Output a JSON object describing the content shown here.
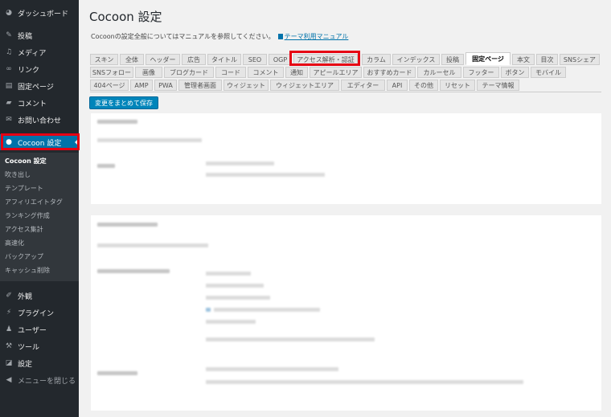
{
  "sidebar": {
    "items": [
      {
        "label": "ダッシュボード",
        "icon": "dashboard-icon"
      },
      {
        "label": "投稿",
        "icon": "pin-icon"
      },
      {
        "label": "メディア",
        "icon": "media-icon"
      },
      {
        "label": "リンク",
        "icon": "link-icon"
      },
      {
        "label": "固定ページ",
        "icon": "page-icon"
      },
      {
        "label": "コメント",
        "icon": "comment-icon"
      },
      {
        "label": "お問い合わせ",
        "icon": "mail-icon"
      },
      {
        "label": "Cocoon 設定",
        "icon": "cocoon-icon"
      },
      {
        "label": "外観",
        "icon": "brush-icon"
      },
      {
        "label": "プラグイン",
        "icon": "plugin-icon"
      },
      {
        "label": "ユーザー",
        "icon": "user-icon"
      },
      {
        "label": "ツール",
        "icon": "wrench-icon"
      },
      {
        "label": "設定",
        "icon": "settings-icon"
      },
      {
        "label": "メニューを閉じる",
        "icon": "collapse-icon"
      }
    ],
    "submenu": [
      "Cocoon 設定",
      "吹き出し",
      "テンプレート",
      "アフィリエイトタグ",
      "ランキング作成",
      "アクセス集計",
      "高速化",
      "バックアップ",
      "キャッシュ削除"
    ]
  },
  "main": {
    "title": "Cocoon 設定",
    "description": "Cocoonの設定全般についてはマニュアルを参照してください。",
    "manual_link": "テーマ利用マニュアル",
    "tabs_row1": [
      "スキン",
      "全体",
      "ヘッダー",
      "広告",
      "タイトル",
      "SEO",
      "OGP",
      "アクセス解析・認証",
      "カラム",
      "インデックス",
      "投稿",
      "固定ページ",
      "本文",
      "目次",
      "SNSシェア"
    ],
    "tabs_row2": [
      "SNSフォロー",
      "画像",
      "ブログカード",
      "コード",
      "コメント",
      "通知",
      "アピールエリア",
      "おすすめカード",
      "カルーセル",
      "フッター",
      "ボタン",
      "モバイル"
    ],
    "tabs_row3": [
      "404ページ",
      "AMP",
      "PWA",
      "管理者画面",
      "ウィジェット",
      "ウィジェットエリア",
      "エディター",
      "API",
      "その他",
      "リセット",
      "テーマ情報"
    ],
    "selected_tab": "固定ページ",
    "save_label": "変更をまとめて保存"
  },
  "colors": {
    "sidebar_bg": "#23282d",
    "active_bg": "#0073aa",
    "highlight": "#e60012",
    "button_bg": "#0085ba"
  }
}
